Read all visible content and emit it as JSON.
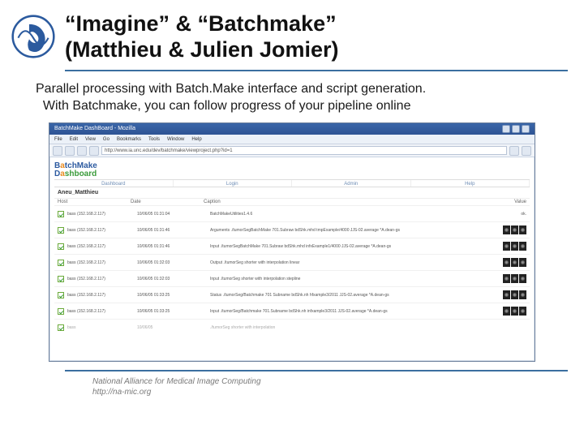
{
  "header": {
    "title_line1": "“Imagine” & “Batchmake”",
    "title_line2": "(Matthieu & Julien Jomier)"
  },
  "body": {
    "line1": "Parallel processing with Batch.Make interface and script generation.",
    "line2": "With Batchmake, you can follow progress of your pipeline online"
  },
  "browser": {
    "title": "BatchMake DashBoard - Mozilla",
    "menus": [
      "File",
      "Edit",
      "View",
      "Go",
      "Bookmarks",
      "Tools",
      "Window",
      "Help"
    ],
    "address": "http://www.ia.unc.edu/dev/batchmake/viewproject.php?id=1"
  },
  "dashboard": {
    "logo1_a": "B",
    "logo1_b": "a",
    "logo1_c": "tchMake",
    "logo2_a": "D",
    "logo2_b": "a",
    "logo2_c": "shboard",
    "tabs": [
      "Dashboard",
      "Login",
      "Admin",
      "Help"
    ],
    "heading": "Aneu_Matthieu",
    "cols": {
      "host": "Host",
      "date": "Date",
      "caption": "Caption",
      "value": "Value"
    },
    "rows": [
      {
        "host": "bass\n(152.168.2.117)",
        "date": "10/06/05\n01:31:04",
        "caption": "BatchMakeUtilities1.4.6",
        "value": "ok.",
        "thumbs": 0
      },
      {
        "host": "bass\n(152.168.2.117)",
        "date": "10/06/05\n01:31:46",
        "caption": "Arguments\n./tumorSegBatchMake 701.Subraw bdShk.mhd tmpExample/4000 JJS-02.average *A.dean-gs",
        "value": "",
        "thumbs": 3
      },
      {
        "host": "bass\n(152.168.2.117)",
        "date": "10/06/05\n01:31:46",
        "caption": "Input\n./tumorSegBatchMake 701.Subraw bdShk.mhd infxExample1/4000 JJS-02.average *A.dean-gs",
        "value": "",
        "thumbs": 3
      },
      {
        "host": "bass\n(152.168.2.117)",
        "date": "10/06/05\n01:32:03",
        "caption": "Output\n./tumorSeg shorter with interpolation  linear",
        "value": "",
        "thumbs": 3
      },
      {
        "host": "bass\n(152.168.2.117)",
        "date": "10/06/05\n01:32:03",
        "caption": "Input\n./tumorSeg shorter with interpolation  stepline",
        "value": "",
        "thumbs": 3
      },
      {
        "host": "bass\n(152.168.2.117)",
        "date": "10/06/05\n01:33:25",
        "caption": "Status\n./tumorSeg/Batchmake 701 Subname bdShk.nh hfxample3/2011 JJS-02.average *A.dean-gs",
        "value": "",
        "thumbs": 3
      },
      {
        "host": "bass\n(152.168.2.117)",
        "date": "10/06/05\n01:33:25",
        "caption": "Input\n./tumorSeg/Batchmake 701.Subname bdShk.nh infxample3/2011 JJS-02.average *A.dean-gs",
        "value": "",
        "thumbs": 3
      },
      {
        "host": "bass",
        "date": "10/06/05",
        "caption": "./tumorSeg shorter with interpolation",
        "value": "",
        "thumbs": 0
      }
    ]
  },
  "footer": {
    "line1": "National Alliance for Medical Image Computing",
    "line2": "http://na-mic.org"
  }
}
